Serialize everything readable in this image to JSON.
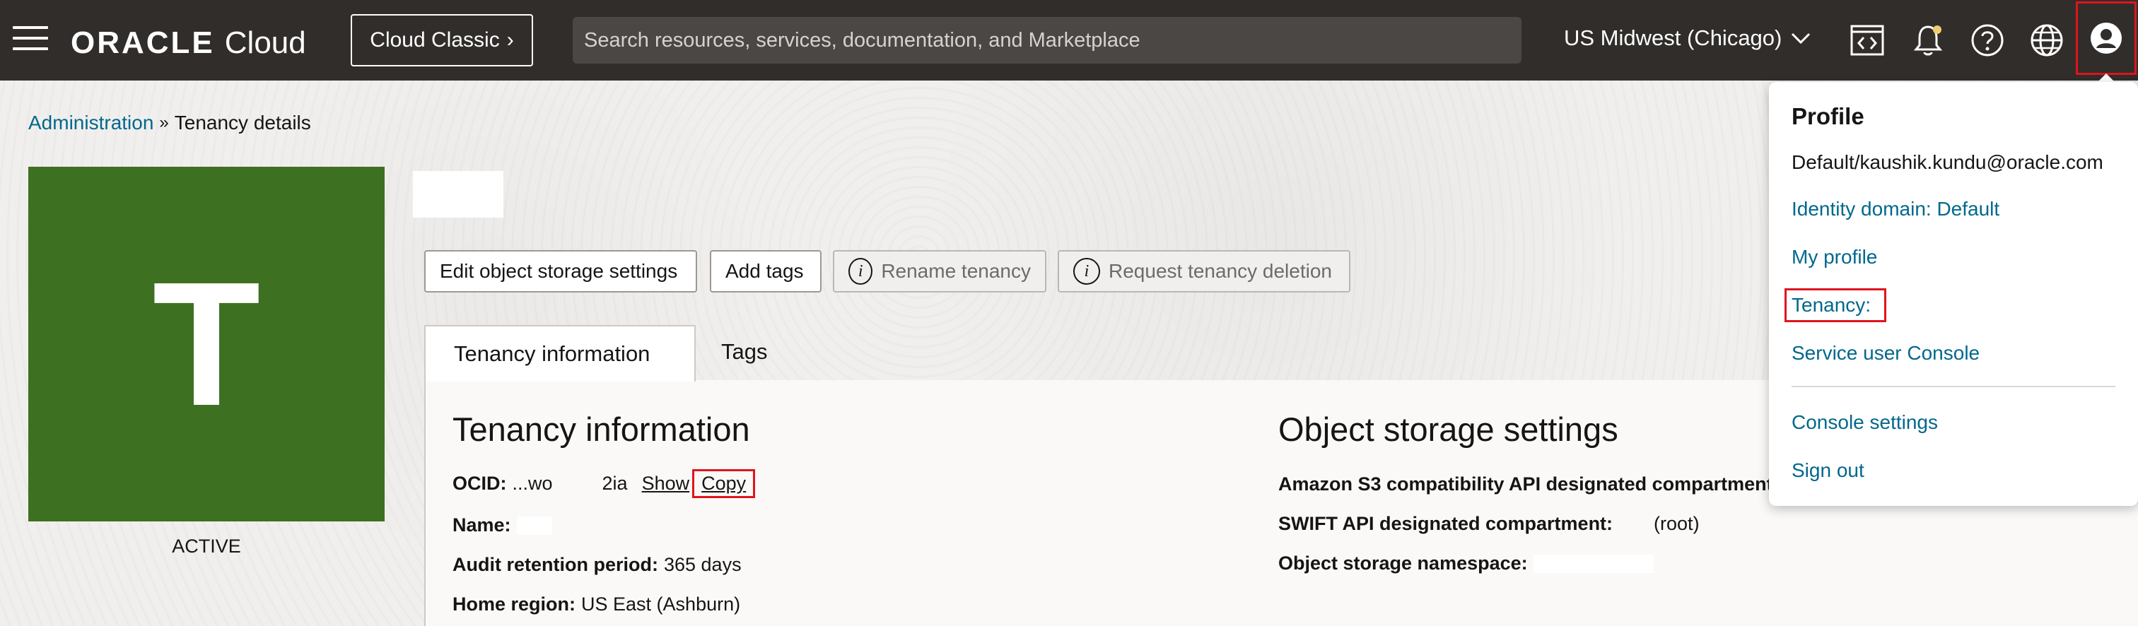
{
  "header": {
    "logo_brand": "ORACLE",
    "logo_product": "Cloud",
    "cloud_classic_label": "Cloud Classic",
    "search_placeholder": "Search resources, services, documentation, and Marketplace",
    "region": "US Midwest (Chicago)",
    "icons": [
      "code-editor-icon",
      "bell-icon",
      "help-icon",
      "globe-icon",
      "profile-icon"
    ],
    "notification_dot_color": "#f0cc71"
  },
  "breadcrumb": {
    "parent": "Administration",
    "separator": "»",
    "current": "Tenancy details"
  },
  "tenancy": {
    "initial": "T",
    "status": "ACTIVE",
    "tile_color": "#3e7022"
  },
  "actions": {
    "edit_storage": "Edit object storage settings",
    "add_tags": "Add tags",
    "rename": "Rename tenancy",
    "request_deletion": "Request tenancy deletion"
  },
  "tabs": {
    "active": "Tenancy information",
    "inactive": "Tags"
  },
  "tenancy_info": {
    "heading": "Tenancy information",
    "ocid_label": "OCID:",
    "ocid_prefix": "...wo",
    "ocid_suffix": "2ia",
    "show_link": "Show",
    "copy_link": "Copy",
    "name_label": "Name:",
    "audit_label": "Audit retention period:",
    "audit_value": "365 days",
    "home_region_label": "Home region:",
    "home_region_value": "US East (Ashburn)"
  },
  "object_storage": {
    "heading": "Object storage settings",
    "s3_label": "Amazon S3 compatibility API designated compartment:",
    "swift_label": "SWIFT API designated compartment:",
    "swift_value": "(root)",
    "namespace_label": "Object storage namespace:"
  },
  "profile_menu": {
    "title": "Profile",
    "user": "Default/kaushik.kundu@oracle.com",
    "identity_domain": "Identity domain: Default",
    "my_profile": "My profile",
    "tenancy": "Tenancy:",
    "service_user_console": "Service user Console",
    "console_settings": "Console settings",
    "sign_out": "Sign out"
  },
  "colors": {
    "header_bg": "#312d2a",
    "link": "#00688c",
    "highlight": "#e0141e"
  }
}
